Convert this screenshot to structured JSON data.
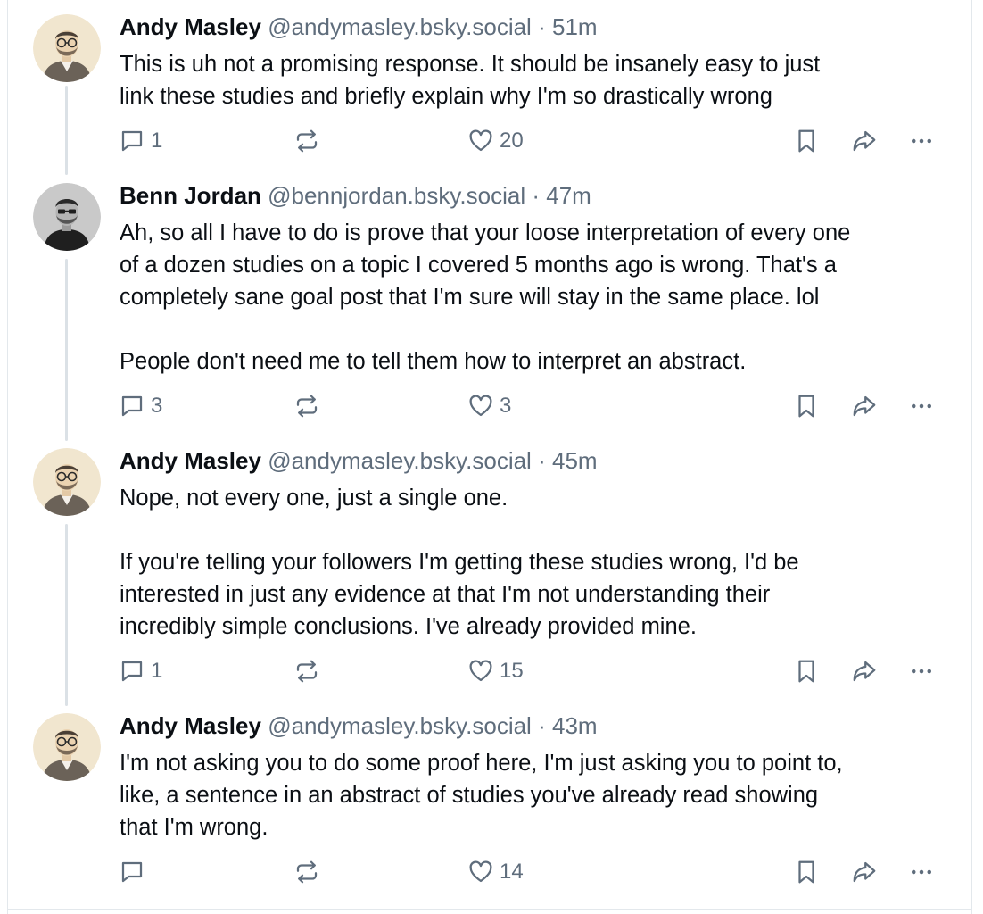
{
  "thread": {
    "posts": [
      {
        "author_name": "Andy Masley",
        "author_handle": "@andymasley.bsky.social",
        "separator": "·",
        "time": "51m",
        "avatar_icon": "avatar-andy-masley",
        "paragraphs": [
          "This is uh not a promising response. It should be insanely easy to just",
          "link these studies and briefly explain why I'm so drastically wrong"
        ],
        "reply_count": "1",
        "like_count": "20"
      },
      {
        "author_name": "Benn Jordan",
        "author_handle": "@bennjordan.bsky.social",
        "separator": "·",
        "time": "47m",
        "avatar_icon": "avatar-benn-jordan",
        "paragraphs": [
          "Ah, so all I have to do is prove that your loose interpretation of every one",
          "of a dozen studies on a topic I covered 5 months ago is wrong. That's a",
          "completely sane goal post that I'm sure will stay in the same place. lol",
          "People don't need me to tell them how to interpret an abstract."
        ],
        "reply_count": "3",
        "like_count": "3"
      },
      {
        "author_name": "Andy Masley",
        "author_handle": "@andymasley.bsky.social",
        "separator": "·",
        "time": "45m",
        "avatar_icon": "avatar-andy-masley",
        "paragraphs": [
          "Nope, not every one, just a single one.",
          "If you're telling your followers I'm getting these studies wrong, I'd be",
          "interested in just any evidence at that I'm not understanding their",
          "incredibly simple conclusions. I've already provided mine."
        ],
        "reply_count": "1",
        "like_count": "15"
      },
      {
        "author_name": "Andy Masley",
        "author_handle": "@andymasley.bsky.social",
        "separator": "·",
        "time": "43m",
        "avatar_icon": "avatar-andy-masley",
        "paragraphs": [
          "I'm not asking you to do some proof here, I'm just asking you to point to,",
          "like, a sentence in an abstract of studies you've already read showing",
          "that I'm wrong."
        ],
        "reply_count": "",
        "like_count": "14"
      }
    ]
  },
  "icons": {
    "reply": "reply-icon",
    "repost": "repost-icon",
    "like": "heart-icon",
    "bookmark": "bookmark-icon",
    "share": "share-icon",
    "more": "more-options-icon"
  },
  "colors": {
    "text": "#0b0f14",
    "muted": "#5f6d7c",
    "thread_line": "#dbe1e6",
    "border": "#e3e8ec"
  }
}
